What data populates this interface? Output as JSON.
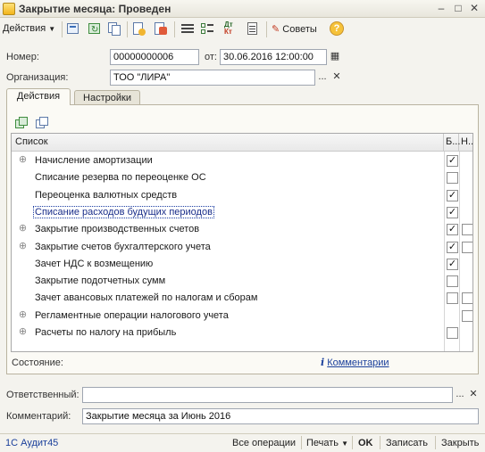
{
  "window": {
    "title": "Закрытие месяца: Проведен"
  },
  "toolbar": {
    "actions_label": "Действия",
    "advice_label": "Советы",
    "help_symbol": "?",
    "dtkt_icon_text": "Дт\nКт"
  },
  "form": {
    "number_label": "Номер:",
    "number_value": "00000000006",
    "date_label": "от:",
    "date_value": "30.06.2016 12:00:00",
    "org_label": "Организация:",
    "org_value": "ТОО \"ЛИРА\""
  },
  "tabs": [
    {
      "label": "Действия",
      "active": true
    },
    {
      "label": "Настройки",
      "active": false
    }
  ],
  "grid": {
    "columns": [
      "Список",
      "Б...",
      "Н..."
    ],
    "rows": [
      {
        "label": "Начисление амортизации",
        "expandable": true,
        "col_b": "checked",
        "col_n": "none",
        "selected": false
      },
      {
        "label": "Списание резерва по переоценке ОС",
        "expandable": false,
        "col_b": "unchecked",
        "col_n": "none",
        "selected": false
      },
      {
        "label": "Переоценка валютных средств",
        "expandable": false,
        "col_b": "checked",
        "col_n": "none",
        "selected": false
      },
      {
        "label": "Списание расходов будущих периодов",
        "expandable": false,
        "col_b": "checked",
        "col_n": "none",
        "selected": true
      },
      {
        "label": "Закрытие производственных счетов",
        "expandable": true,
        "col_b": "checked",
        "col_n": "unchecked",
        "selected": false
      },
      {
        "label": "Закрытие счетов бухгалтерского учета",
        "expandable": true,
        "col_b": "checked",
        "col_n": "unchecked",
        "selected": false
      },
      {
        "label": "Зачет НДС к возмещению",
        "expandable": false,
        "col_b": "checked",
        "col_n": "none",
        "selected": false
      },
      {
        "label": "Закрытие подотчетных сумм",
        "expandable": false,
        "col_b": "unchecked",
        "col_n": "none",
        "selected": false
      },
      {
        "label": "Зачет авансовых платежей по налогам и сборам",
        "expandable": false,
        "col_b": "unchecked",
        "col_n": "unchecked",
        "selected": false
      },
      {
        "label": "Регламентные операции налогового учета",
        "expandable": true,
        "col_b": "none",
        "col_n": "unchecked",
        "selected": false
      },
      {
        "label": "Расчеты по налогу на прибыль",
        "expandable": true,
        "col_b": "unchecked",
        "col_n": "none",
        "selected": false
      }
    ]
  },
  "status": {
    "label": "Состояние:",
    "comments_link": "Комментарии"
  },
  "responsible": {
    "label": "Ответственный:",
    "value": ""
  },
  "comment": {
    "label": "Комментарий:",
    "value": "Закрытие месяца за Июнь 2016"
  },
  "footer": {
    "user": "1С Аудит45",
    "all_ops": "Все операции",
    "print": "Печать",
    "ok": "OK",
    "save": "Записать",
    "close": "Закрыть"
  },
  "colors": {
    "checkmark": "#111111",
    "link": "#1a3f9b",
    "accent_yellow": "#f6c23a"
  }
}
